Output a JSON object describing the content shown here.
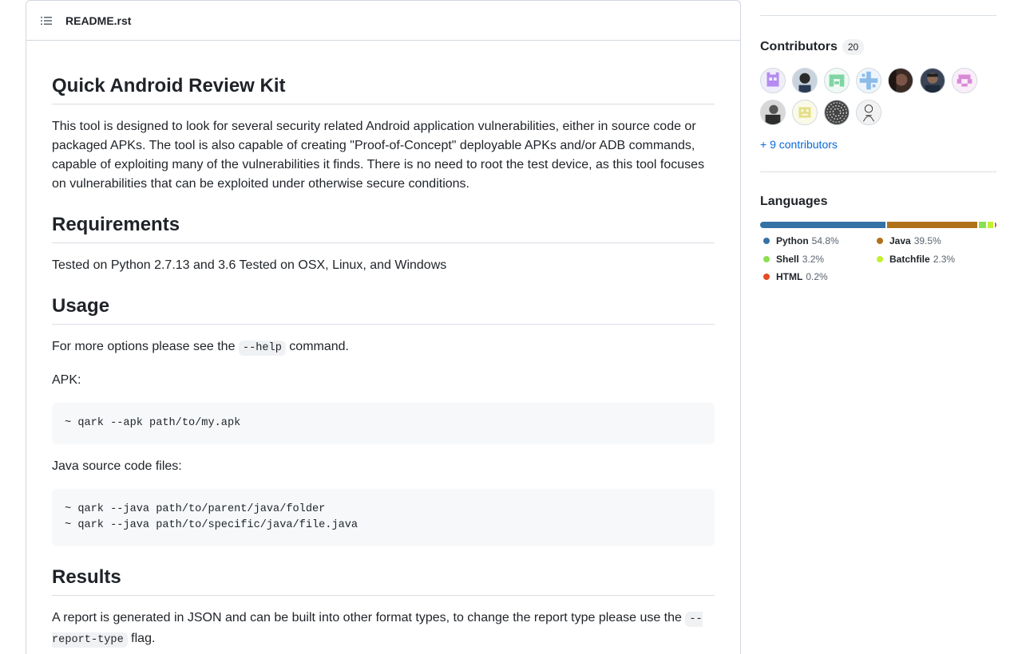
{
  "readme": {
    "filename": "README.rst",
    "title": "Quick Android Review Kit",
    "intro": "This tool is designed to look for several security related Android application vulnerabilities, either in source code or packaged APKs. The tool is also capable of creating \"Proof-of-Concept\" deployable APKs and/or ADB commands, capable of exploiting many of the vulnerabilities it finds. There is no need to root the test device, as this tool focuses on vulnerabilities that can be exploited under otherwise secure conditions.",
    "requirements_heading": "Requirements",
    "requirements_text": "Tested on Python 2.7.13 and 3.6 Tested on OSX, Linux, and Windows",
    "usage_heading": "Usage",
    "usage_text_before": "For more options please see the ",
    "usage_code": "--help",
    "usage_text_after": " command.",
    "apk_label": "APK:",
    "apk_code": "~ qark --apk path/to/my.apk",
    "java_label": "Java source code files:",
    "java_code": "~ qark --java path/to/parent/java/folder\n~ qark --java path/to/specific/java/file.java",
    "results_heading": "Results",
    "results_text_before": "A report is generated in JSON and can be built into other format types, to change the report type please use the ",
    "results_code": "--report-type",
    "results_text_after": " flag."
  },
  "contributors": {
    "title": "Contributors",
    "count": "20",
    "more_link": "+ 9 contributors",
    "avatars": [
      "avatar-1",
      "avatar-2",
      "avatar-3",
      "avatar-4",
      "avatar-5",
      "avatar-6",
      "avatar-7",
      "avatar-8",
      "avatar-9",
      "avatar-10",
      "avatar-11"
    ]
  },
  "languages": {
    "title": "Languages",
    "items": [
      {
        "name": "Python",
        "percent": "54.8%",
        "value": 54.8,
        "color": "#3572A5"
      },
      {
        "name": "Java",
        "percent": "39.5%",
        "value": 39.5,
        "color": "#b07219"
      },
      {
        "name": "Shell",
        "percent": "3.2%",
        "value": 3.2,
        "color": "#89e051"
      },
      {
        "name": "Batchfile",
        "percent": "2.3%",
        "value": 2.3,
        "color": "#C1F12E"
      },
      {
        "name": "HTML",
        "percent": "0.2%",
        "value": 0.2,
        "color": "#e34c26"
      }
    ]
  }
}
